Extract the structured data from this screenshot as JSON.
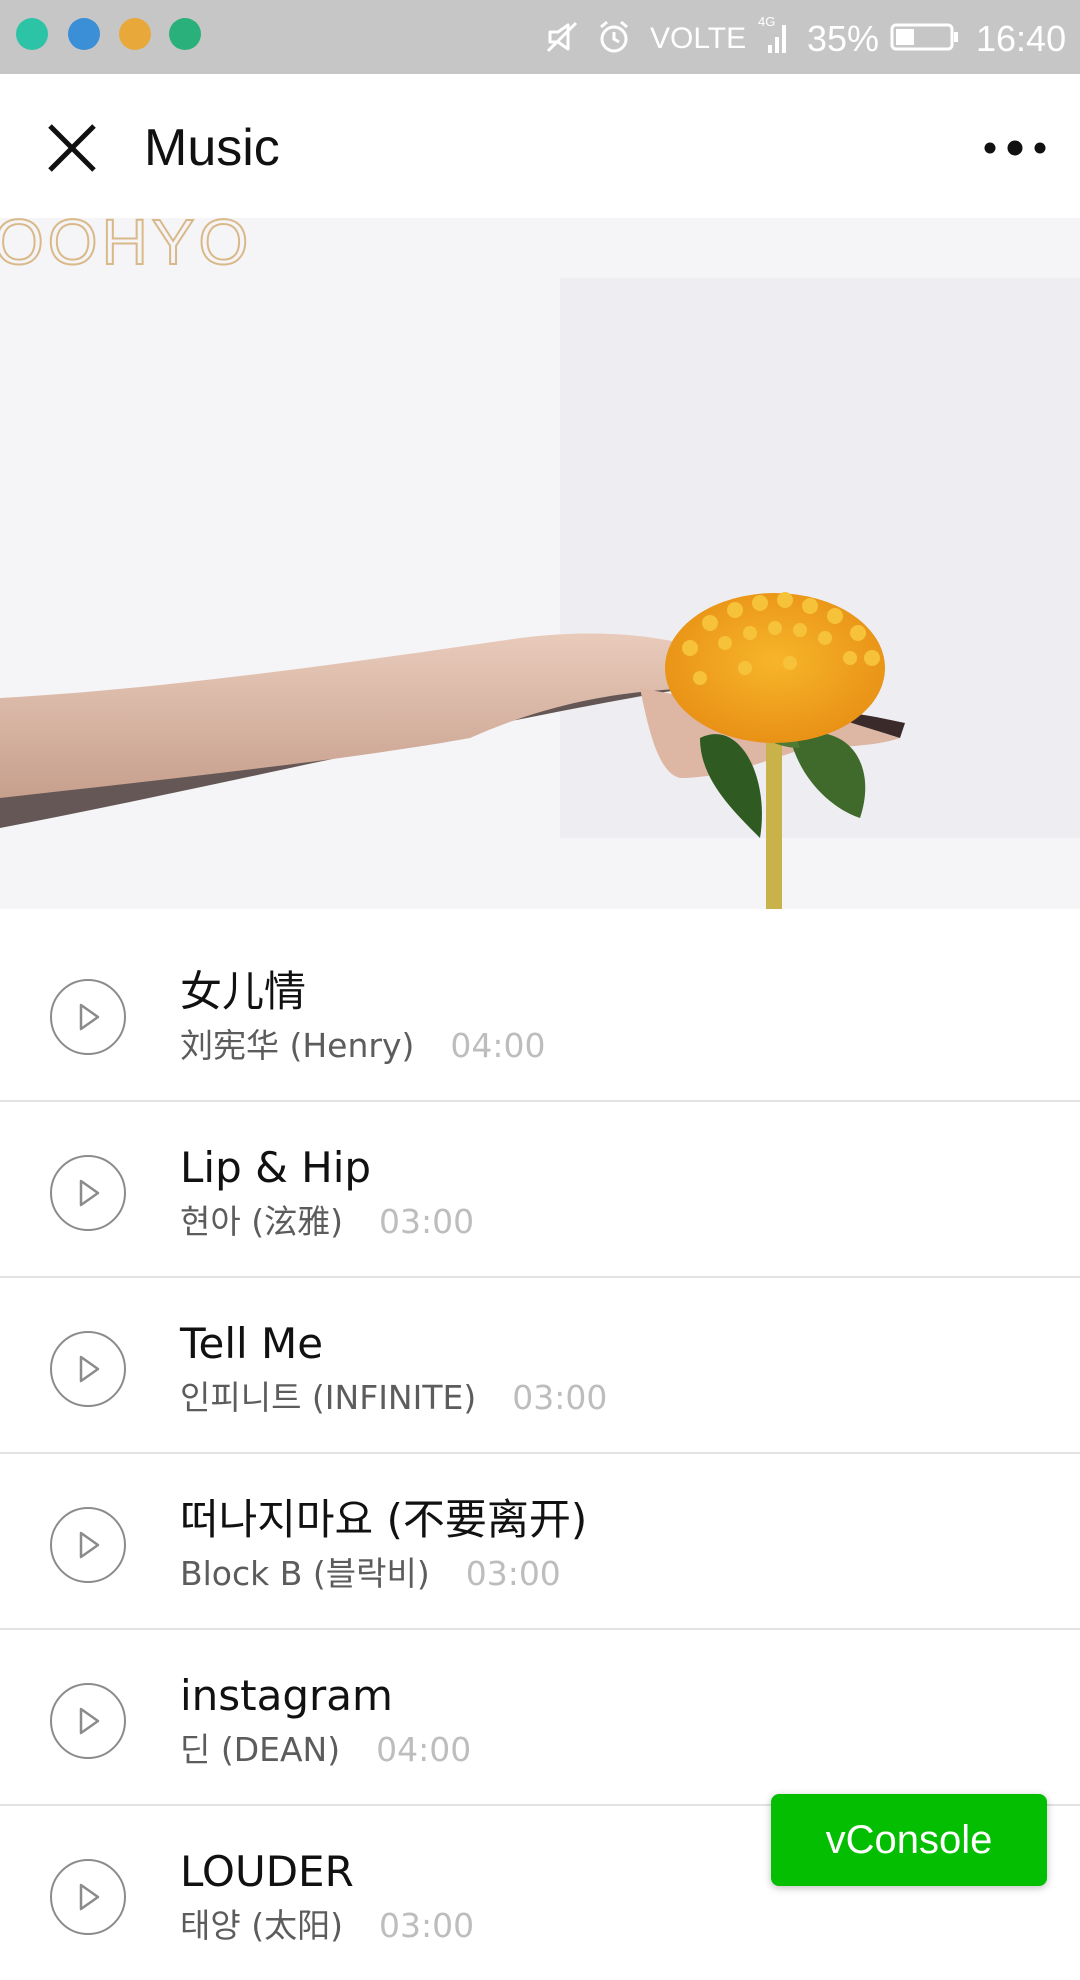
{
  "status_bar": {
    "app_icons": [
      {
        "name": "smiley-app-icon",
        "color": "#2dc3a7"
      },
      {
        "name": "browser-app-icon",
        "color": "#3a8fd6"
      },
      {
        "name": "coin-app-icon",
        "color": "#e8a93a"
      },
      {
        "name": "shield-app-icon",
        "color": "#2ab07a"
      }
    ],
    "network": "VOLTE",
    "signal_type": "4G",
    "battery_percent": "35%",
    "battery_level": 0.35,
    "time": "16:40"
  },
  "header": {
    "title": "Music",
    "close_icon": "close-icon",
    "more_icon": "more-icon"
  },
  "cover": {
    "text": "OOHYO"
  },
  "tracks": [
    {
      "title": "女儿情",
      "artist": "刘宪华 (Henry)",
      "duration": "04:00"
    },
    {
      "title": "Lip & Hip",
      "artist": "현아 (泫雅)",
      "duration": "03:00"
    },
    {
      "title": "Tell Me",
      "artist": "인피니트 (INFINITE)",
      "duration": "03:00"
    },
    {
      "title": "떠나지마요 (不要离开)",
      "artist": "Block B (블락비)",
      "duration": "03:00"
    },
    {
      "title": "instagram",
      "artist": "딘 (DEAN)",
      "duration": "04:00"
    },
    {
      "title": "LOUDER",
      "artist": "태양 (太阳)",
      "duration": "03:00"
    }
  ],
  "vconsole": {
    "label": "vConsole",
    "color": "#04be02"
  }
}
